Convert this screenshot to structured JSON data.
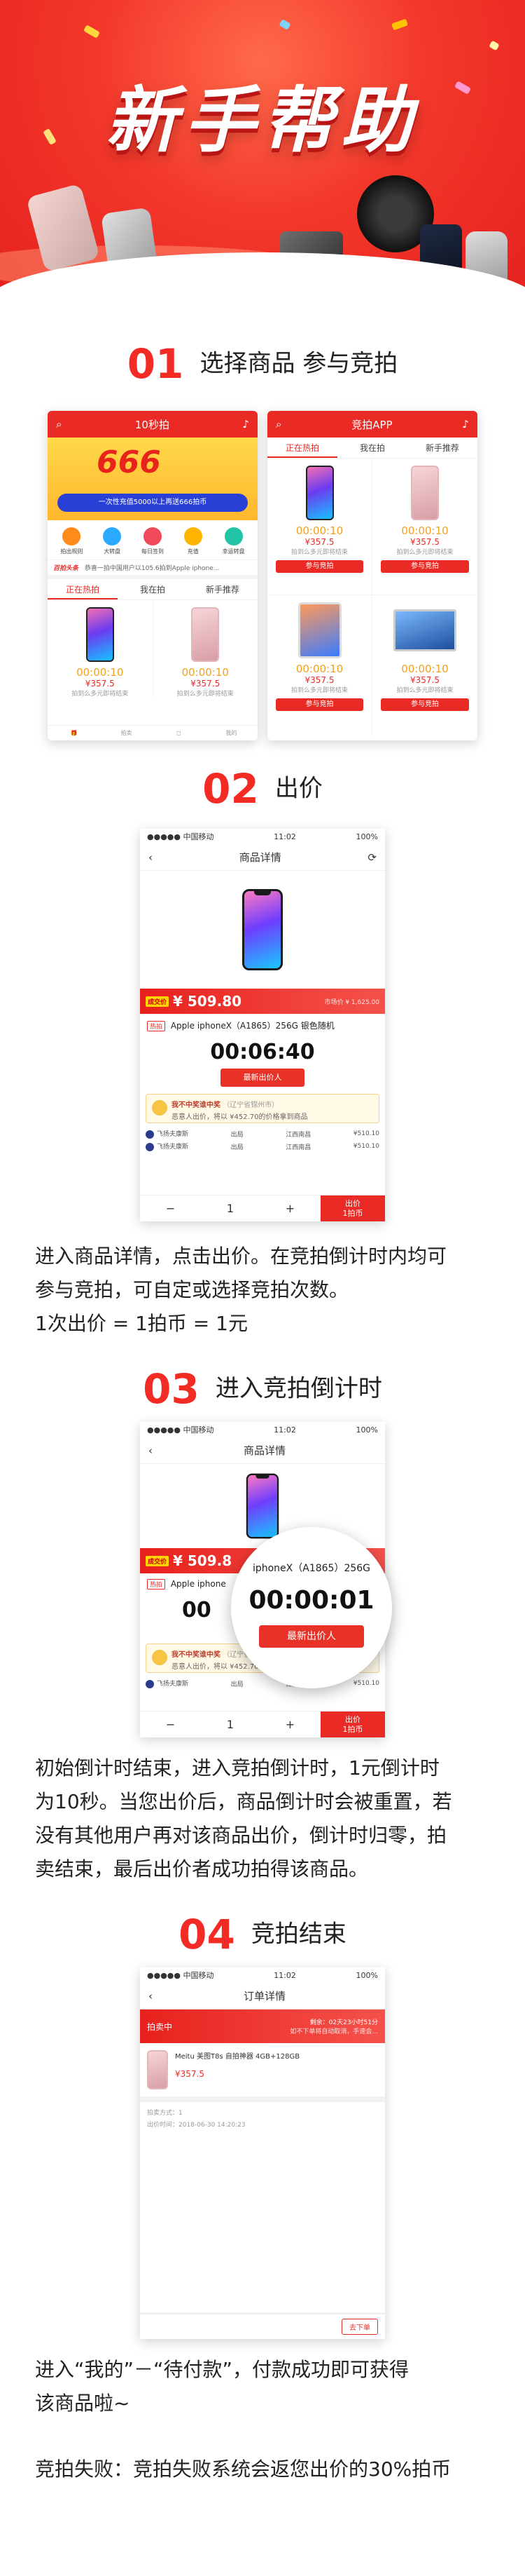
{
  "hero": {
    "title": "新手帮助"
  },
  "steps": [
    {
      "num": "01",
      "title": "选择商品  参与竞拍"
    },
    {
      "num": "02",
      "title": "出价"
    },
    {
      "num": "03",
      "title": "进入竞拍倒计时"
    },
    {
      "num": "04",
      "title": "竞拍结束"
    }
  ],
  "home_screen": {
    "app_title": "10秒拍",
    "banner_big": "666",
    "banner_line": "一次性充值5000以上再送666拍币",
    "icons": [
      "拍出规则",
      "大转盘",
      "每日签到",
      "充值",
      "幸运转盘"
    ],
    "news_label": "百拍头条",
    "news_text": "恭喜一拍中国用户以105.6拍到Apple iphone...",
    "tabs": [
      "正在热拍",
      "我在拍",
      "新手推荐"
    ],
    "items": [
      {
        "timer": "00:00:10",
        "price": "¥357.5",
        "note": "拍到么多元即将结束"
      },
      {
        "timer": "00:00:10",
        "price": "¥357.5",
        "note": "拍到么多元即将结束"
      }
    ],
    "bottom_tabs": [
      "",
      "拍卖",
      "",
      "我的"
    ]
  },
  "list_screen": {
    "app_title": "竞拍APP",
    "tabs": [
      "正在热拍",
      "我在拍",
      "新手推荐"
    ],
    "items": [
      {
        "timer": "00:00:10",
        "price": "¥357.5",
        "note": "拍到么多元即将结束",
        "button": "参与竞拍"
      },
      {
        "timer": "00:00:10",
        "price": "¥357.5",
        "note": "拍到么多元即将结束",
        "button": "参与竞拍"
      },
      {
        "timer": "00:00:10",
        "price": "¥357.5",
        "note": "拍到么多元即将结束",
        "button": "参与竞拍"
      },
      {
        "timer": "00:00:10",
        "price": "¥357.5",
        "note": "拍到么多元即将结束",
        "button": "参与竞拍"
      }
    ]
  },
  "detail_screen": {
    "carrier": "●●●●● 中国移动",
    "time": "11:02",
    "battery": "100%",
    "title": "商品详情",
    "price_tag": "成交价",
    "price": "¥ 509.80",
    "market_price": "市场价 ¥ 1,625.00",
    "product_tag": "热拍",
    "product_name": "Apple iphoneX（A1865）256G 银色随机",
    "timer": "00:06:40",
    "ribbon": "最新出价人",
    "winner_title": "我不中奖谁中奖",
    "winner_sub": "（辽宁省锦州市）",
    "winner_desc": "恶意人出价，将以 ¥452.70的价格拿到商品",
    "bids": [
      {
        "name": "飞扬夫康斯",
        "status": "出局",
        "region": "江西南昌",
        "amount": "¥510.10"
      },
      {
        "name": "飞扬夫康斯",
        "status": "出局",
        "region": "江西南昌",
        "amount": "¥510.10"
      }
    ],
    "stepper_minus": "−",
    "stepper_value": "1",
    "stepper_plus": "+",
    "bid_button": "出价",
    "bid_button_sub": "1拍币"
  },
  "step2_text": [
    "进入商品详情，点击出价。在竞拍倒计时内均可",
    "参与竞拍，可自定或选择竞拍次数。",
    "1次出价 = 1拍币 = 1元"
  ],
  "step3_screen": {
    "title": "商品详情",
    "price": "¥ 509.8",
    "product_name": "Apple iphone",
    "timer_partial": "00",
    "magnifier_product": "iphoneX（A1865）256G",
    "magnifier_timer": "00:00:01",
    "magnifier_ribbon": "最新出价人",
    "bid_button": "出价",
    "bid_button_sub": "1拍币"
  },
  "step3_text": [
    "初始倒计时结束，进入竞拍倒计时，1元倒计时",
    "为10秒。当您出价后，商品倒计时会被重置，若",
    "没有其他用户再对该商品出价，倒计时归零，拍",
    "卖结束，最后出价者成功拍得该商品。"
  ],
  "order_screen": {
    "title": "订单详情",
    "status": "拍卖中",
    "countdown_label": "剩余：02天23小时51分",
    "countdown_sub": "如不下单将自动取消，手速会...",
    "product_name": "Meitu 美图T8s 自拍神器 4GB+128GB",
    "product_price": "¥357.5",
    "meta_1": "拍卖方式：1",
    "meta_2": "出价时间：2018-06-30 14:20:23",
    "button": "去下单"
  },
  "step4_text": [
    "进入“我的”－“待付款”，付款成功即可获得",
    "该商品啦~"
  ],
  "footer_text": "竞拍失败：竞拍失败系统会返您出价的30%拍币"
}
